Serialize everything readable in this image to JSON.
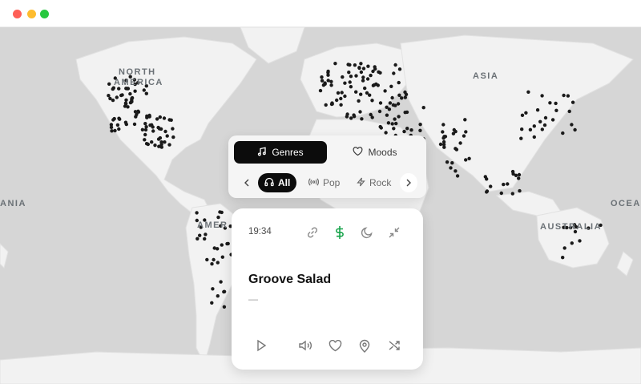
{
  "window": {
    "controls": [
      "close",
      "minimize",
      "maximize"
    ]
  },
  "map": {
    "labels": {
      "north_america_1": "NORTH",
      "north_america_2": "AMERICA",
      "asia": "ASIA",
      "oceania_left": "ANIA",
      "oceania_right": "OCEAN",
      "south_america": "AMER",
      "australia": "AUSTRALIA"
    },
    "colors": {
      "water": "#d6d6d6",
      "land": "#f2f2f2",
      "station": "#1a1a1a"
    }
  },
  "tabs": {
    "genres_label": "Genres",
    "moods_label": "Moods",
    "active": "Genres",
    "chips": {
      "all": "All",
      "pop": "Pop",
      "rock": "Rock"
    },
    "active_chip": "All"
  },
  "player": {
    "time": "19:34",
    "title": "Groove Salad",
    "subtitle": "—",
    "accent": "#16a34a",
    "top_icons": [
      "link-icon",
      "dollar-icon",
      "moon-icon",
      "minimize-icon"
    ],
    "bottom_icons": [
      "play-icon",
      "volume-icon",
      "heart-icon",
      "location-pin-icon",
      "shuffle-icon"
    ]
  }
}
